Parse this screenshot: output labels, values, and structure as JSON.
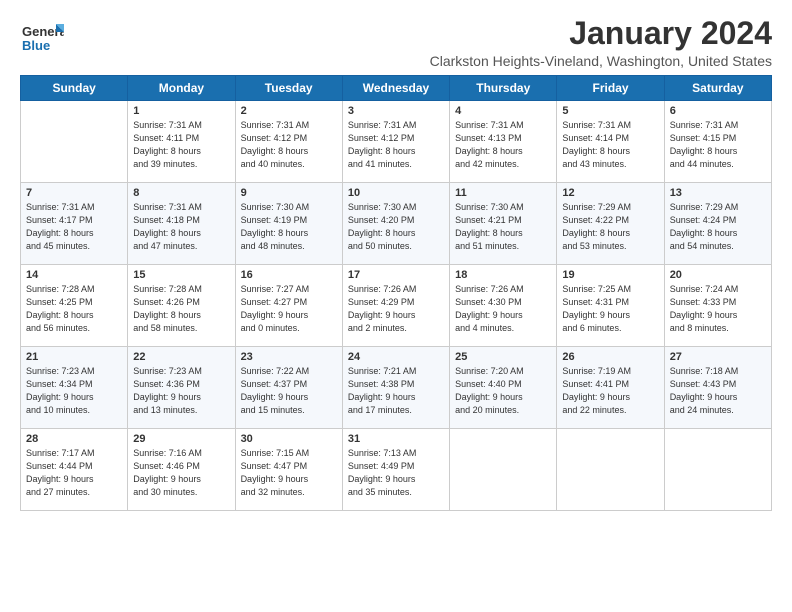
{
  "header": {
    "logo_line1": "General",
    "logo_line2": "Blue",
    "month_title": "January 2024",
    "location": "Clarkston Heights-Vineland, Washington, United States"
  },
  "weekdays": [
    "Sunday",
    "Monday",
    "Tuesday",
    "Wednesday",
    "Thursday",
    "Friday",
    "Saturday"
  ],
  "weeks": [
    [
      {
        "day": "",
        "info": ""
      },
      {
        "day": "1",
        "info": "Sunrise: 7:31 AM\nSunset: 4:11 PM\nDaylight: 8 hours\nand 39 minutes."
      },
      {
        "day": "2",
        "info": "Sunrise: 7:31 AM\nSunset: 4:12 PM\nDaylight: 8 hours\nand 40 minutes."
      },
      {
        "day": "3",
        "info": "Sunrise: 7:31 AM\nSunset: 4:12 PM\nDaylight: 8 hours\nand 41 minutes."
      },
      {
        "day": "4",
        "info": "Sunrise: 7:31 AM\nSunset: 4:13 PM\nDaylight: 8 hours\nand 42 minutes."
      },
      {
        "day": "5",
        "info": "Sunrise: 7:31 AM\nSunset: 4:14 PM\nDaylight: 8 hours\nand 43 minutes."
      },
      {
        "day": "6",
        "info": "Sunrise: 7:31 AM\nSunset: 4:15 PM\nDaylight: 8 hours\nand 44 minutes."
      }
    ],
    [
      {
        "day": "7",
        "info": "Sunrise: 7:31 AM\nSunset: 4:17 PM\nDaylight: 8 hours\nand 45 minutes."
      },
      {
        "day": "8",
        "info": "Sunrise: 7:31 AM\nSunset: 4:18 PM\nDaylight: 8 hours\nand 47 minutes."
      },
      {
        "day": "9",
        "info": "Sunrise: 7:30 AM\nSunset: 4:19 PM\nDaylight: 8 hours\nand 48 minutes."
      },
      {
        "day": "10",
        "info": "Sunrise: 7:30 AM\nSunset: 4:20 PM\nDaylight: 8 hours\nand 50 minutes."
      },
      {
        "day": "11",
        "info": "Sunrise: 7:30 AM\nSunset: 4:21 PM\nDaylight: 8 hours\nand 51 minutes."
      },
      {
        "day": "12",
        "info": "Sunrise: 7:29 AM\nSunset: 4:22 PM\nDaylight: 8 hours\nand 53 minutes."
      },
      {
        "day": "13",
        "info": "Sunrise: 7:29 AM\nSunset: 4:24 PM\nDaylight: 8 hours\nand 54 minutes."
      }
    ],
    [
      {
        "day": "14",
        "info": "Sunrise: 7:28 AM\nSunset: 4:25 PM\nDaylight: 8 hours\nand 56 minutes."
      },
      {
        "day": "15",
        "info": "Sunrise: 7:28 AM\nSunset: 4:26 PM\nDaylight: 8 hours\nand 58 minutes."
      },
      {
        "day": "16",
        "info": "Sunrise: 7:27 AM\nSunset: 4:27 PM\nDaylight: 9 hours\nand 0 minutes."
      },
      {
        "day": "17",
        "info": "Sunrise: 7:26 AM\nSunset: 4:29 PM\nDaylight: 9 hours\nand 2 minutes."
      },
      {
        "day": "18",
        "info": "Sunrise: 7:26 AM\nSunset: 4:30 PM\nDaylight: 9 hours\nand 4 minutes."
      },
      {
        "day": "19",
        "info": "Sunrise: 7:25 AM\nSunset: 4:31 PM\nDaylight: 9 hours\nand 6 minutes."
      },
      {
        "day": "20",
        "info": "Sunrise: 7:24 AM\nSunset: 4:33 PM\nDaylight: 9 hours\nand 8 minutes."
      }
    ],
    [
      {
        "day": "21",
        "info": "Sunrise: 7:23 AM\nSunset: 4:34 PM\nDaylight: 9 hours\nand 10 minutes."
      },
      {
        "day": "22",
        "info": "Sunrise: 7:23 AM\nSunset: 4:36 PM\nDaylight: 9 hours\nand 13 minutes."
      },
      {
        "day": "23",
        "info": "Sunrise: 7:22 AM\nSunset: 4:37 PM\nDaylight: 9 hours\nand 15 minutes."
      },
      {
        "day": "24",
        "info": "Sunrise: 7:21 AM\nSunset: 4:38 PM\nDaylight: 9 hours\nand 17 minutes."
      },
      {
        "day": "25",
        "info": "Sunrise: 7:20 AM\nSunset: 4:40 PM\nDaylight: 9 hours\nand 20 minutes."
      },
      {
        "day": "26",
        "info": "Sunrise: 7:19 AM\nSunset: 4:41 PM\nDaylight: 9 hours\nand 22 minutes."
      },
      {
        "day": "27",
        "info": "Sunrise: 7:18 AM\nSunset: 4:43 PM\nDaylight: 9 hours\nand 24 minutes."
      }
    ],
    [
      {
        "day": "28",
        "info": "Sunrise: 7:17 AM\nSunset: 4:44 PM\nDaylight: 9 hours\nand 27 minutes."
      },
      {
        "day": "29",
        "info": "Sunrise: 7:16 AM\nSunset: 4:46 PM\nDaylight: 9 hours\nand 30 minutes."
      },
      {
        "day": "30",
        "info": "Sunrise: 7:15 AM\nSunset: 4:47 PM\nDaylight: 9 hours\nand 32 minutes."
      },
      {
        "day": "31",
        "info": "Sunrise: 7:13 AM\nSunset: 4:49 PM\nDaylight: 9 hours\nand 35 minutes."
      },
      {
        "day": "",
        "info": ""
      },
      {
        "day": "",
        "info": ""
      },
      {
        "day": "",
        "info": ""
      }
    ]
  ]
}
